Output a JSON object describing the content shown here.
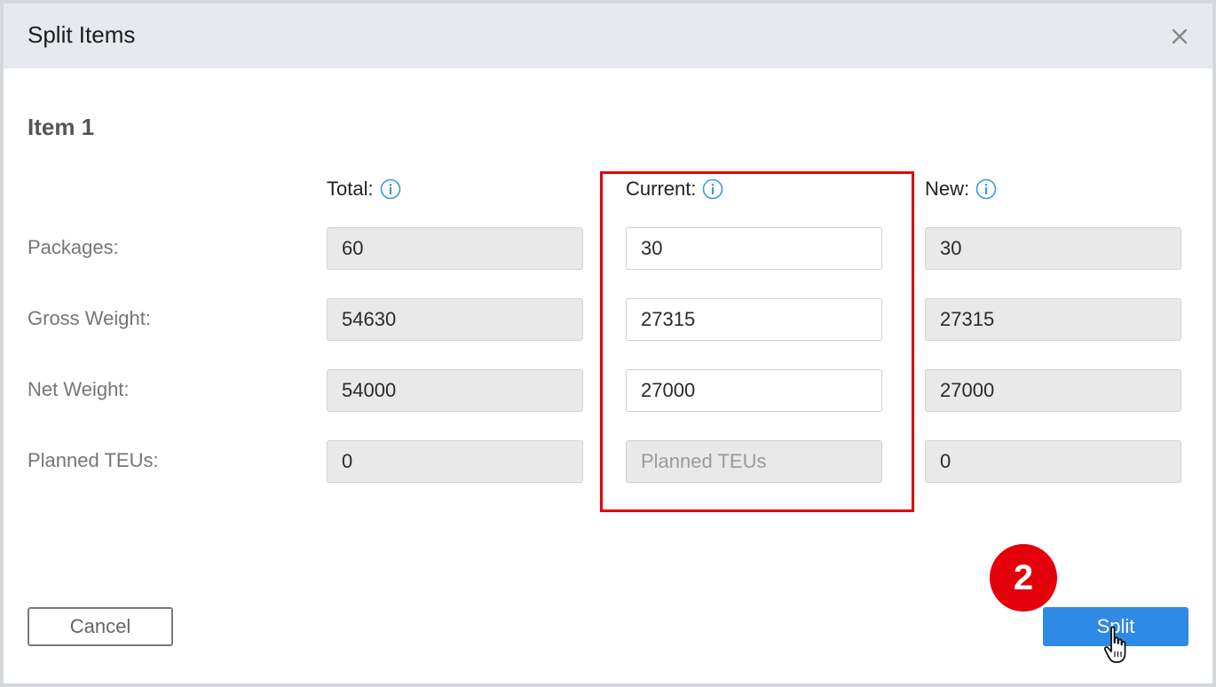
{
  "dialog": {
    "title": "Split Items",
    "close_icon": "close-icon"
  },
  "item": {
    "title": "Item 1"
  },
  "columns": {
    "total": "Total:",
    "current": "Current:",
    "new": "New:",
    "info_icon": "info-icon"
  },
  "rows": {
    "packages": {
      "label": "Packages:",
      "total": "60",
      "current": "30",
      "new": "30"
    },
    "gross_weight": {
      "label": "Gross Weight:",
      "total": "54630",
      "current": "27315",
      "new": "27315"
    },
    "net_weight": {
      "label": "Net Weight:",
      "total": "54000",
      "current": "27000",
      "new": "27000"
    },
    "planned_teus": {
      "label": "Planned TEUs:",
      "total": "0",
      "current_placeholder": "Planned TEUs",
      "new": "0"
    }
  },
  "actions": {
    "cancel_label": "Cancel",
    "split_label": "Split"
  },
  "annotation": {
    "step_number": "2",
    "highlight_color": "#e3000b"
  },
  "colors": {
    "primary": "#2f8ae5",
    "header_bg": "#e6e9ed",
    "readonly_bg": "#e9e9e9"
  }
}
